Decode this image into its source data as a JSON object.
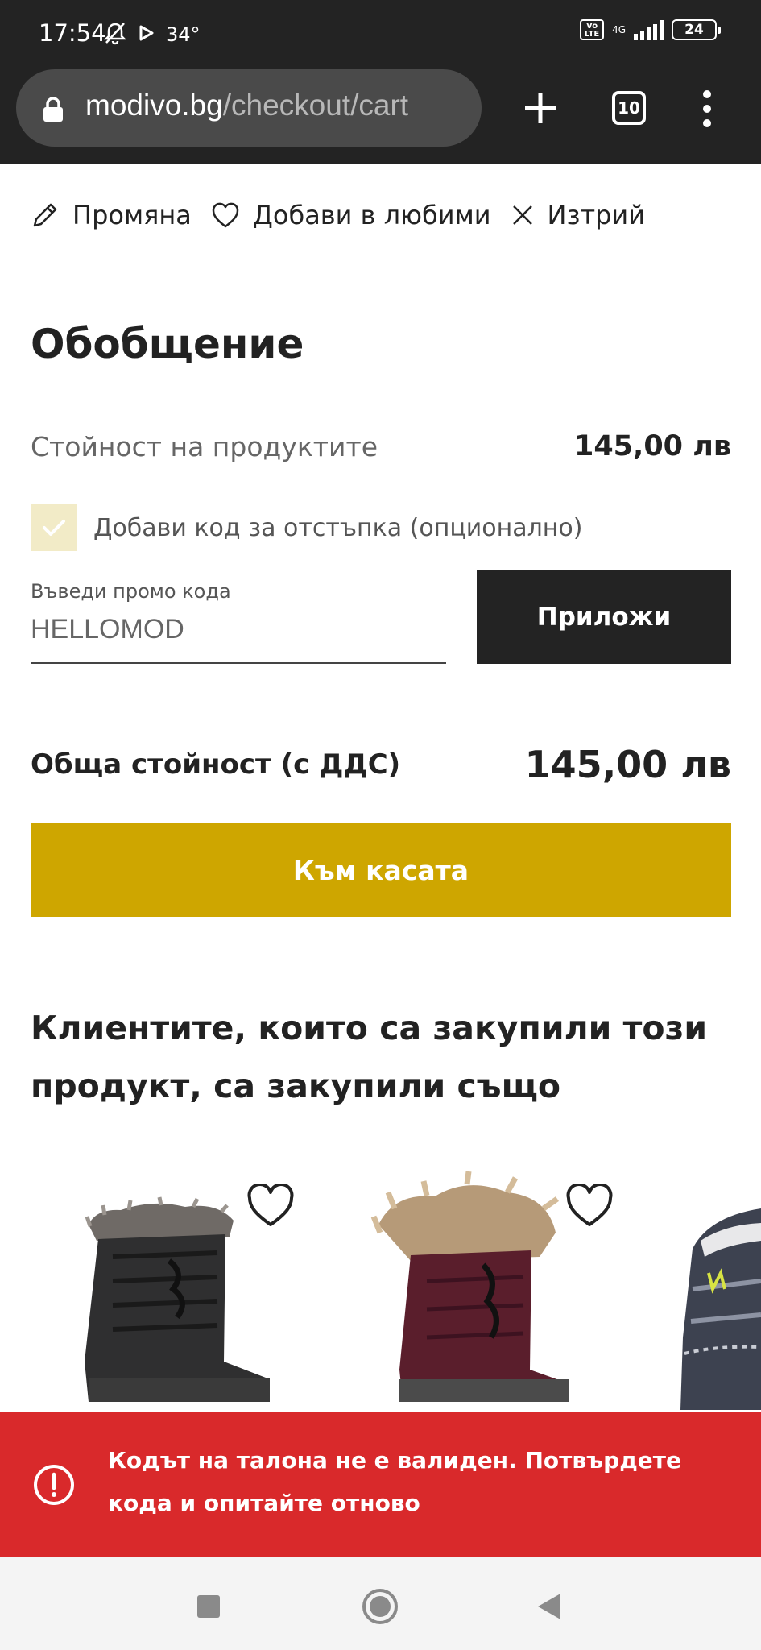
{
  "status_bar": {
    "time": "17:54",
    "temperature": "34°",
    "volte": "Vo LTE",
    "network": "4G",
    "battery": "24",
    "icons": [
      "bell-off-icon",
      "play-icon",
      "volte-icon",
      "signal-icon",
      "battery-icon"
    ]
  },
  "browser": {
    "url_domain": "modivo.bg",
    "url_path": "/checkout/cart",
    "tab_count": "10",
    "icons": [
      "lock-icon",
      "plus-icon",
      "tabs-icon",
      "more-vert-icon"
    ]
  },
  "cart_actions": {
    "edit_label": "Промяна",
    "favorite_label": "Добави в любими",
    "delete_label": "Изтрий",
    "icons": [
      "pencil-icon",
      "heart-icon",
      "close-icon"
    ]
  },
  "summary": {
    "title": "Обобщение",
    "products_value_label": "Стойност на продуктите",
    "products_value": "145,00 лв",
    "promo_checkbox_label": "Добави код за отстъпка (опционално)",
    "promo_checkbox_checked": true,
    "promo_field_label": "Въведи промо кода",
    "promo_field_value": "HELLOMOD",
    "apply_button": "Приложи",
    "total_label": "Обща стойност (с ДДС)",
    "total_value": "145,00 лв",
    "checkout_button": "Към касата"
  },
  "recommendations": {
    "title": "Клиентите, които са закупили този продукт, са закупили също",
    "products": [
      {
        "image": "black-snow-boot-with-fur"
      },
      {
        "image": "burgundy-snow-boot-with-fur"
      },
      {
        "image": "grey-winter-boot-partial",
        "brand_mark": "CMP"
      }
    ]
  },
  "toast": {
    "message": "Кодът на талона не е валиден. Потвърдете кода и опитайте отново",
    "icon": "alert-circle-icon",
    "color": "#d9292b"
  },
  "colors": {
    "accent": "#cea600",
    "dark": "#232323",
    "checkbox_bg": "#f2ebc7"
  }
}
